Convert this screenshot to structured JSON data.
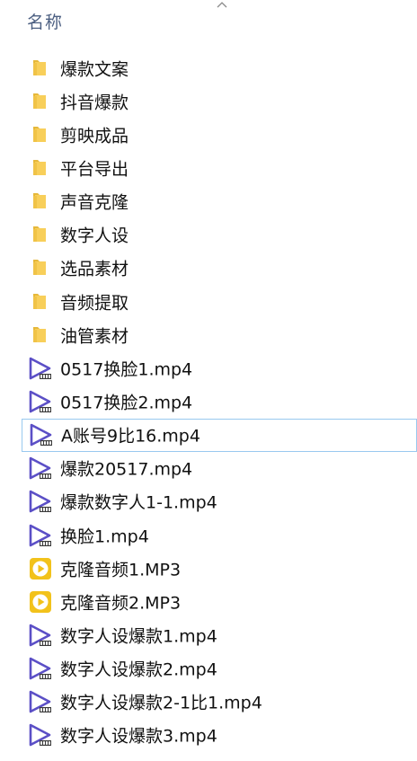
{
  "header": {
    "name_column": "名称"
  },
  "items": [
    {
      "type": "folder",
      "name": "爆款文案",
      "icon": "folder-icon"
    },
    {
      "type": "folder",
      "name": "抖音爆款",
      "icon": "folder-icon"
    },
    {
      "type": "folder",
      "name": "剪映成品",
      "icon": "folder-icon"
    },
    {
      "type": "folder",
      "name": "平台导出",
      "icon": "folder-icon"
    },
    {
      "type": "folder",
      "name": "声音克隆",
      "icon": "folder-icon"
    },
    {
      "type": "folder",
      "name": "数字人设",
      "icon": "folder-icon"
    },
    {
      "type": "folder",
      "name": "选品素材",
      "icon": "folder-icon"
    },
    {
      "type": "folder",
      "name": "音频提取",
      "icon": "folder-icon"
    },
    {
      "type": "folder",
      "name": "油管素材",
      "icon": "folder-icon"
    },
    {
      "type": "video",
      "name": "0517换脸1.mp4",
      "icon": "video-file-icon"
    },
    {
      "type": "video",
      "name": "0517换脸2.mp4",
      "icon": "video-file-icon"
    },
    {
      "type": "video",
      "name": "A账号9比16.mp4",
      "icon": "video-file-icon",
      "selected": true
    },
    {
      "type": "video",
      "name": "爆款20517.mp4",
      "icon": "video-file-icon"
    },
    {
      "type": "video",
      "name": "爆款数字人1-1.mp4",
      "icon": "video-file-icon"
    },
    {
      "type": "video",
      "name": "换脸1.mp4",
      "icon": "video-file-icon"
    },
    {
      "type": "audio",
      "name": "克隆音频1.MP3",
      "icon": "audio-file-icon"
    },
    {
      "type": "audio",
      "name": "克隆音频2.MP3",
      "icon": "audio-file-icon"
    },
    {
      "type": "video",
      "name": "数字人设爆款1.mp4",
      "icon": "video-file-icon"
    },
    {
      "type": "video",
      "name": "数字人设爆款2.mp4",
      "icon": "video-file-icon"
    },
    {
      "type": "video",
      "name": "数字人设爆款2-1比1.mp4",
      "icon": "video-file-icon"
    },
    {
      "type": "video",
      "name": "数字人设爆款3.mp4",
      "icon": "video-file-icon"
    }
  ],
  "colors": {
    "folder": "#f8cf5a",
    "folder_dark": "#e6b83a",
    "video_triangle": "#5b4fc6",
    "audio_circle": "#f2c21b",
    "selection_border": "#99c9ef",
    "header_text": "#4d6082"
  }
}
